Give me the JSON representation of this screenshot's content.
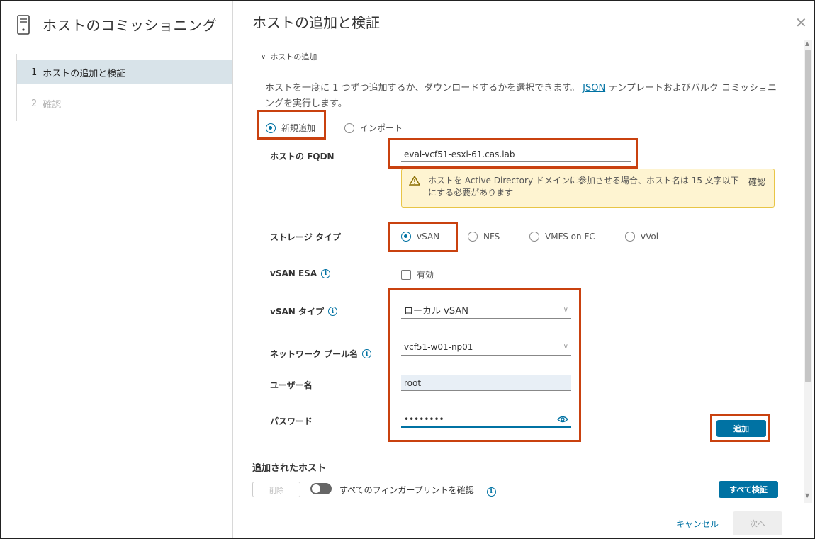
{
  "sidebar": {
    "title": "ホストのコミッショニング",
    "icon": "server-icon",
    "steps": [
      {
        "num": "1",
        "label": "ホストの追加と検証",
        "state": "active"
      },
      {
        "num": "2",
        "label": "確認",
        "state": "disabled"
      }
    ]
  },
  "main": {
    "title": "ホストの追加と検証",
    "section": "ホストの追加",
    "desc_before": "ホストを一度に 1 つずつ追加するか、ダウンロードするかを選択できます。",
    "desc_link": "JSON",
    "desc_after": "テンプレートおよびバルク コミッショニングを実行します。",
    "mode": {
      "option_new": "新規追加",
      "option_import": "インポート",
      "selected": "新規追加"
    },
    "fields": {
      "fqdn_label": "ホストの FQDN",
      "fqdn_value": "eval-vcf51-esxi-61.cas.lab",
      "warning_text": "ホストを Active Directory ドメインに参加させる場合、ホスト名は 15 文字以下にする必要があります",
      "warning_link": "確認",
      "storage_label": "ストレージ タイプ",
      "storage_options": [
        "vSAN",
        "NFS",
        "VMFS on FC",
        "vVol"
      ],
      "storage_selected": "vSAN",
      "esa_label": "vSAN ESA",
      "esa_checkbox": "有効",
      "vsan_type_label": "vSAN タイプ",
      "vsan_type_value": "ローカル vSAN",
      "network_pool_label": "ネットワーク プール名",
      "network_pool_value": "vcf51-w01-np01",
      "username_label": "ユーザー名",
      "username_value": "root",
      "password_label": "パスワード",
      "password_value": "••••••••"
    },
    "add_button": "追加",
    "added_hosts_title": "追加されたホスト",
    "remove_button": "削除",
    "fingerprint_toggle": "すべてのフィンガープリントを確認",
    "validate_all_button": "すべて検証",
    "cancel_button": "キャンセル",
    "next_button": "次へ"
  },
  "colors": {
    "accent": "#0072a3",
    "highlight": "#c9410f",
    "warning_bg": "#fef4d1"
  }
}
